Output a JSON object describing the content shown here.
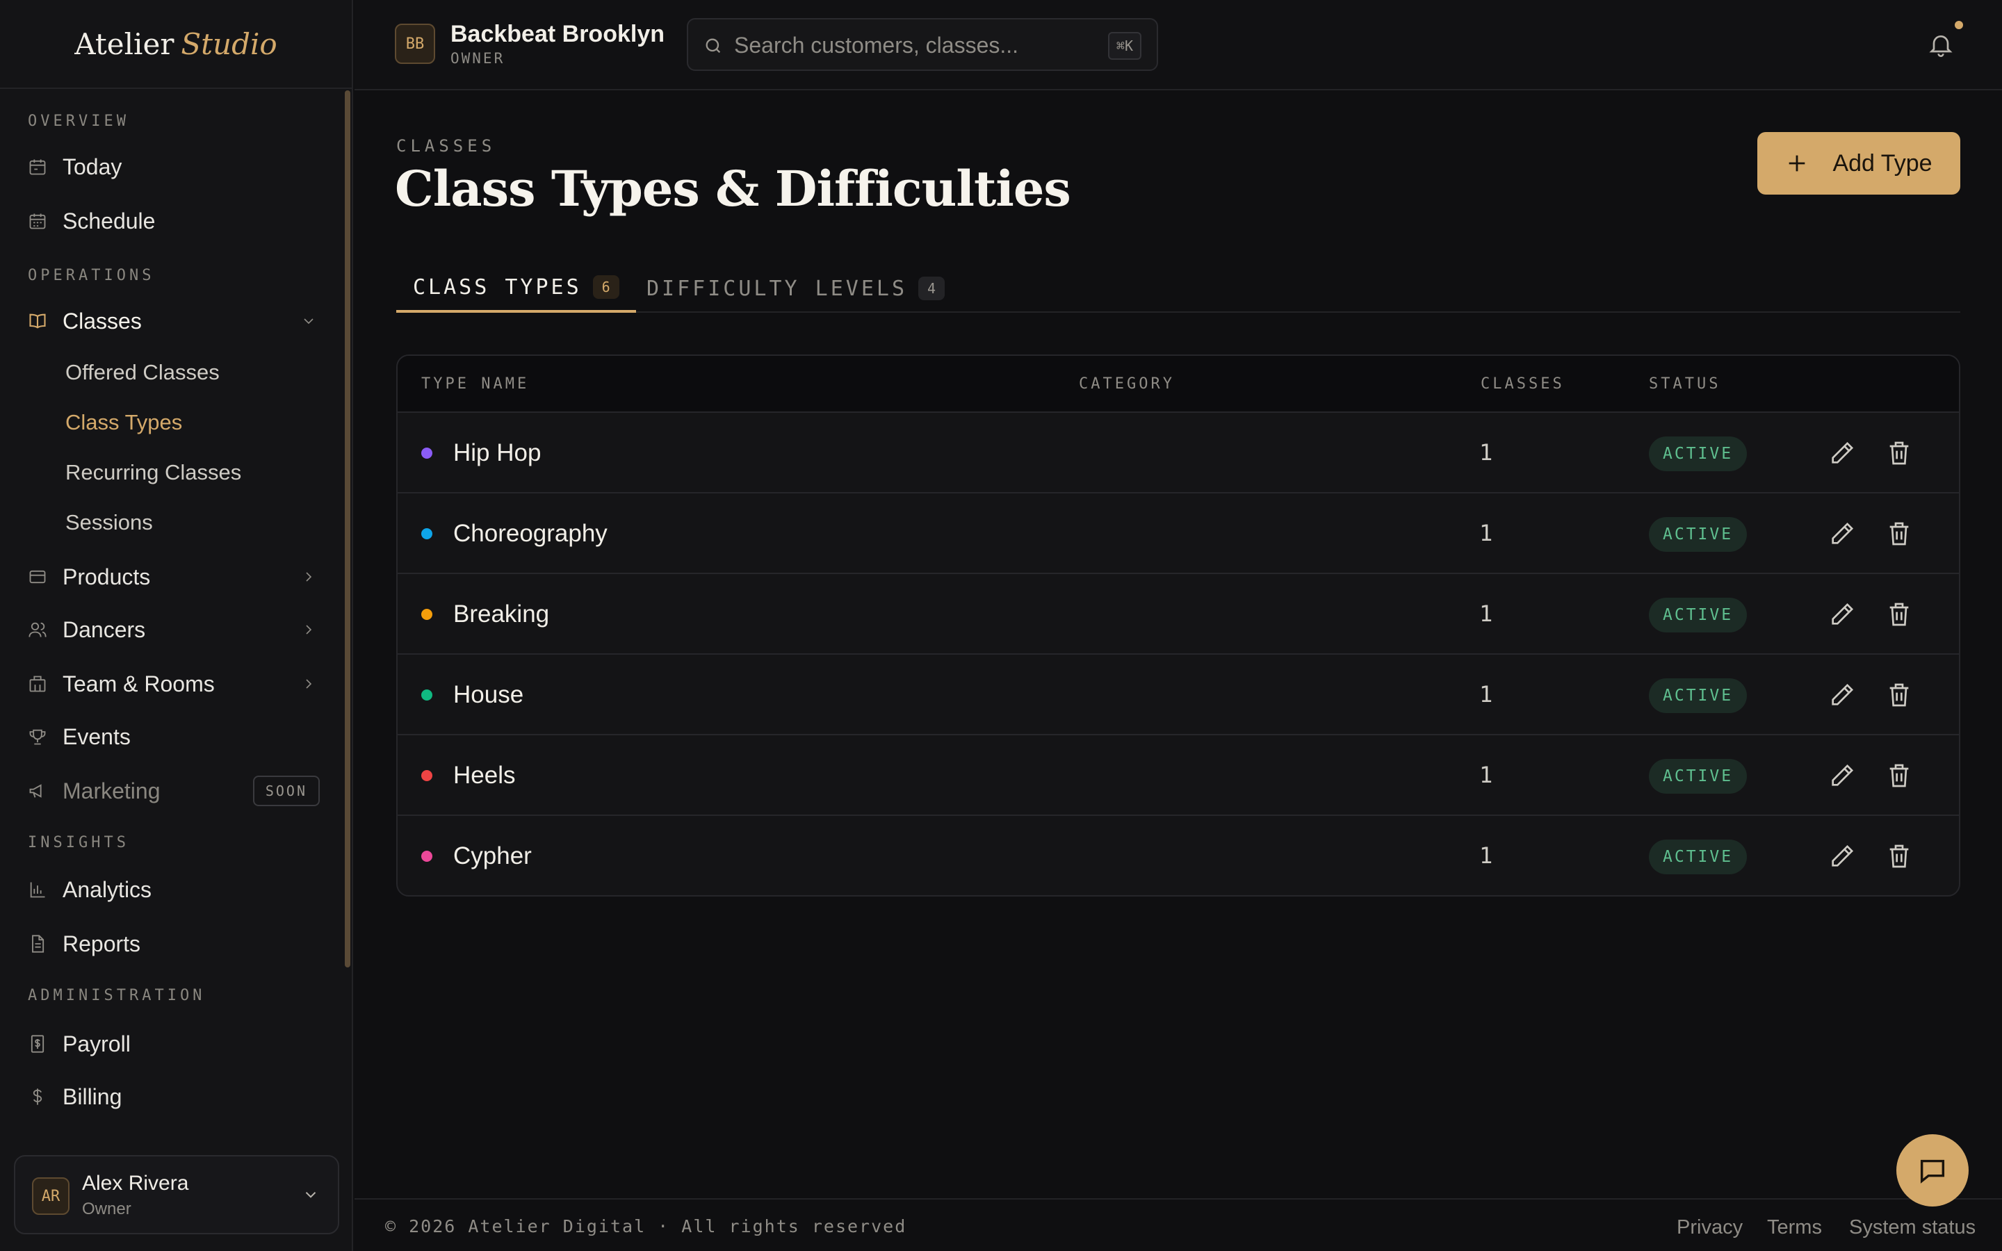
{
  "brand": {
    "name": "Atelier",
    "accent": "Studio"
  },
  "sidebar": {
    "sections": [
      "OVERVIEW",
      "OPERATIONS",
      "INSIGHTS",
      "ADMINISTRATION"
    ],
    "items": {
      "today": "Today",
      "schedule": "Schedule",
      "classes": "Classes",
      "products": "Products",
      "dancers": "Dancers",
      "team": "Team & Rooms",
      "events": "Events",
      "marketing": "Marketing",
      "marketing_badge": "SOON",
      "analytics": "Analytics",
      "reports": "Reports",
      "payroll": "Payroll",
      "billing": "Billing"
    },
    "sub_items": [
      "Offered Classes",
      "Class Types",
      "Recurring Classes",
      "Sessions"
    ],
    "user": {
      "initials": "AR",
      "name": "Alex Rivera",
      "role": "Owner"
    }
  },
  "topbar": {
    "org_initials": "BB",
    "org_name": "Backbeat Brooklyn",
    "org_role": "OWNER",
    "search_placeholder": "Search customers, classes...",
    "shortcut": "⌘K"
  },
  "page": {
    "eyebrow": "CLASSES",
    "title": "Class Types & Difficulties",
    "add_button": "Add Type"
  },
  "tabs": [
    {
      "label": "CLASS TYPES",
      "count": "6"
    },
    {
      "label": "DIFFICULTY LEVELS",
      "count": "4"
    }
  ],
  "table": {
    "headers": [
      "TYPE NAME",
      "CATEGORY",
      "CLASSES",
      "STATUS"
    ],
    "rows": [
      {
        "name": "Hip Hop",
        "color": "#8b5cf6",
        "category": "",
        "classes": "1",
        "status": "ACTIVE"
      },
      {
        "name": "Choreography",
        "color": "#0ea5e9",
        "category": "",
        "classes": "1",
        "status": "ACTIVE"
      },
      {
        "name": "Breaking",
        "color": "#f59e0b",
        "category": "",
        "classes": "1",
        "status": "ACTIVE"
      },
      {
        "name": "House",
        "color": "#10b981",
        "category": "",
        "classes": "1",
        "status": "ACTIVE"
      },
      {
        "name": "Heels",
        "color": "#ef4444",
        "category": "",
        "classes": "1",
        "status": "ACTIVE"
      },
      {
        "name": "Cypher",
        "color": "#ec4899",
        "category": "",
        "classes": "1",
        "status": "ACTIVE"
      }
    ]
  },
  "footer": {
    "copyright": "© 2026 Atelier Digital · All rights reserved",
    "links": [
      "Privacy",
      "Terms",
      "System status"
    ]
  },
  "colors": {
    "accent": "#d4a96a",
    "background": "#0f0f11",
    "status_active": "#5fbf8f"
  }
}
